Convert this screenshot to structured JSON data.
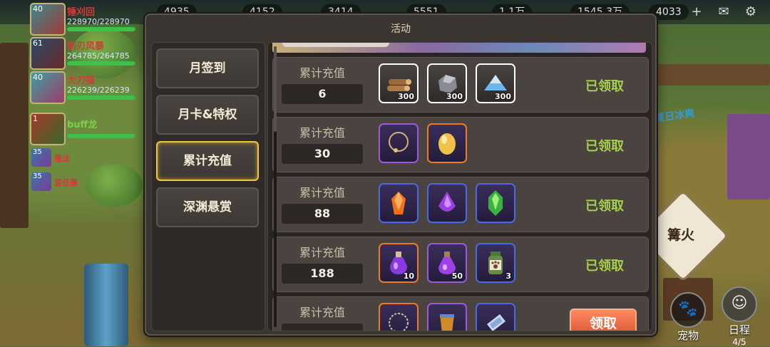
{
  "hud": {
    "resources": [
      "4935",
      "4152",
      "3414",
      "5551",
      "1.1万",
      "1545.3万",
      "4033"
    ],
    "plus_icon": "plus-icon",
    "mail_icon": "mail-icon",
    "settings_icon": "gear-icon"
  },
  "party": [
    {
      "level": "40",
      "name": "锤刈回",
      "hp": "228970/228970",
      "hp_fraction": 1.0
    },
    {
      "level": "61",
      "name": "剑刃风暴",
      "hp": "264785/264785",
      "hp_fraction": 1.0
    },
    {
      "level": "40",
      "name": "大刀猫",
      "hp": "226239/226239",
      "hp_fraction": 1.0
    },
    {
      "level": "1",
      "name": "buff龙",
      "hp": "",
      "hp_fraction": 1.0
    }
  ],
  "minions": [
    {
      "level": "35",
      "name": "墨汰"
    },
    {
      "level": "35",
      "name": "蓝任墨"
    }
  ],
  "world": {
    "campfire_label": "篝火",
    "pet_button": "宠物",
    "schedule_button": "日程",
    "schedule_count": "4/5",
    "sign_text": "夏日冰爽"
  },
  "panel": {
    "title": "活动",
    "tabs": [
      {
        "label": "月签到",
        "active": false
      },
      {
        "label": "月卡&特权",
        "active": false
      },
      {
        "label": "累计充值",
        "active": true
      },
      {
        "label": "深渊悬赏",
        "active": false
      }
    ],
    "rows": [
      {
        "label": "累计充值",
        "amount": "6",
        "status": "已领取",
        "claimable": false,
        "items": [
          {
            "icon": "wood-logs-icon",
            "rarity": "white",
            "count": "300"
          },
          {
            "icon": "iron-ore-icon",
            "rarity": "white",
            "count": "300"
          },
          {
            "icon": "crystal-dust-icon",
            "rarity": "white",
            "count": "300"
          }
        ]
      },
      {
        "label": "累计充值",
        "amount": "30",
        "status": "已领取",
        "claimable": false,
        "items": [
          {
            "icon": "necklace-icon",
            "rarity": "purple",
            "count": ""
          },
          {
            "icon": "golden-egg-icon",
            "rarity": "orange",
            "count": ""
          }
        ]
      },
      {
        "label": "累计充值",
        "amount": "88",
        "status": "已领取",
        "claimable": false,
        "items": [
          {
            "icon": "orange-gem-icon",
            "rarity": "blue",
            "count": ""
          },
          {
            "icon": "purple-gem-icon",
            "rarity": "blue",
            "count": ""
          },
          {
            "icon": "green-gem-icon",
            "rarity": "blue",
            "count": ""
          }
        ]
      },
      {
        "label": "累计充值",
        "amount": "188",
        "status": "已领取",
        "claimable": false,
        "items": [
          {
            "icon": "purple-potion-icon",
            "rarity": "orange",
            "count": "10"
          },
          {
            "icon": "purple-flask-icon",
            "rarity": "purple",
            "count": "50"
          },
          {
            "icon": "paw-jar-icon",
            "rarity": "blue",
            "count": "3"
          }
        ]
      },
      {
        "label": "累计充值",
        "amount": "",
        "status": "领取",
        "claimable": true,
        "items": [
          {
            "icon": "ring-necklace-icon",
            "rarity": "orange",
            "count": ""
          },
          {
            "icon": "bucket-icon",
            "rarity": "purple",
            "count": ""
          },
          {
            "icon": "scroll-icon",
            "rarity": "blue",
            "count": ""
          }
        ]
      }
    ]
  }
}
